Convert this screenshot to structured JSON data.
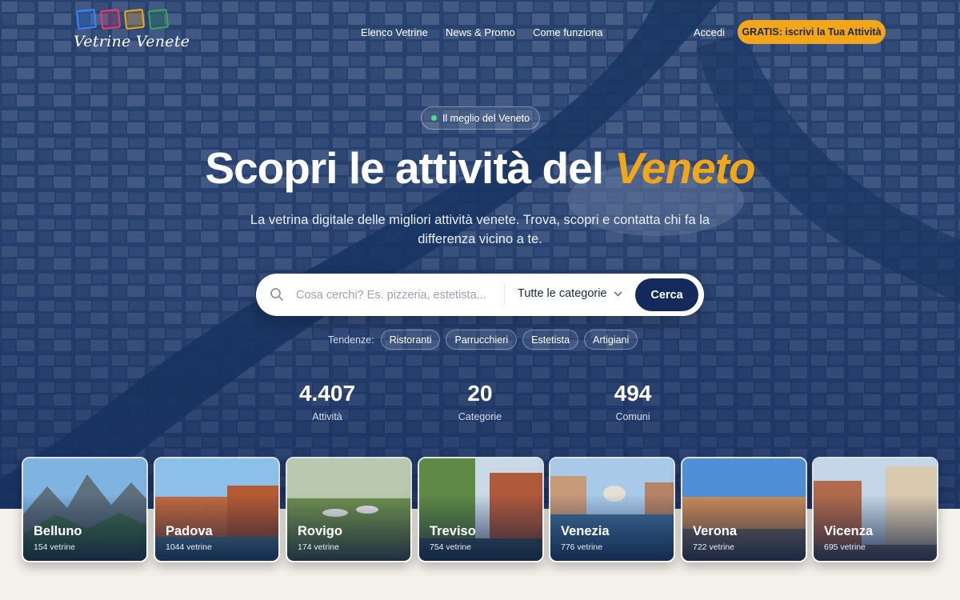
{
  "brand": {
    "logo_text": "Vetrine Venete",
    "square_colors": [
      "#3b82f6",
      "#e63e6d",
      "#f3a619",
      "#3aa55d"
    ]
  },
  "nav": {
    "links": [
      "Elenco Vetrine",
      "News & Promo",
      "Come funziona"
    ],
    "login": "Accedi",
    "cta": "GRATIS: iscrivi la Tua Attività"
  },
  "hero": {
    "badge": "Il meglio del Veneto",
    "title_main": "Scopri le attività del",
    "title_accent": "Veneto",
    "subtitle": "La vetrina digitale delle migliori attività venete. Trova, scopri e contatta chi fa la differenza vicino a te."
  },
  "search": {
    "placeholder": "Cosa cerchi? Es. pizzeria, estetista...",
    "category_selected": "Tutte le categorie",
    "button": "Cerca"
  },
  "trends": {
    "label": "Tendenze:",
    "items": [
      "Ristoranti",
      "Parrucchieri",
      "Estetista",
      "Artigiani"
    ]
  },
  "stats": [
    {
      "value": "4.407",
      "label": "Attività"
    },
    {
      "value": "20",
      "label": "Categorie"
    },
    {
      "value": "494",
      "label": "Comuni"
    }
  ],
  "provinces": [
    {
      "name": "Belluno",
      "count": "154 vetrine"
    },
    {
      "name": "Padova",
      "count": "1044 vetrine"
    },
    {
      "name": "Rovigo",
      "count": "174 vetrine"
    },
    {
      "name": "Treviso",
      "count": "754 vetrine"
    },
    {
      "name": "Venezia",
      "count": "776 vetrine"
    },
    {
      "name": "Verona",
      "count": "722 vetrine"
    },
    {
      "name": "Vicenza",
      "count": "695 vetrine"
    }
  ],
  "colors": {
    "accent": "#f3a619",
    "primary": "#14295c",
    "cream": "#f4f1ea"
  }
}
